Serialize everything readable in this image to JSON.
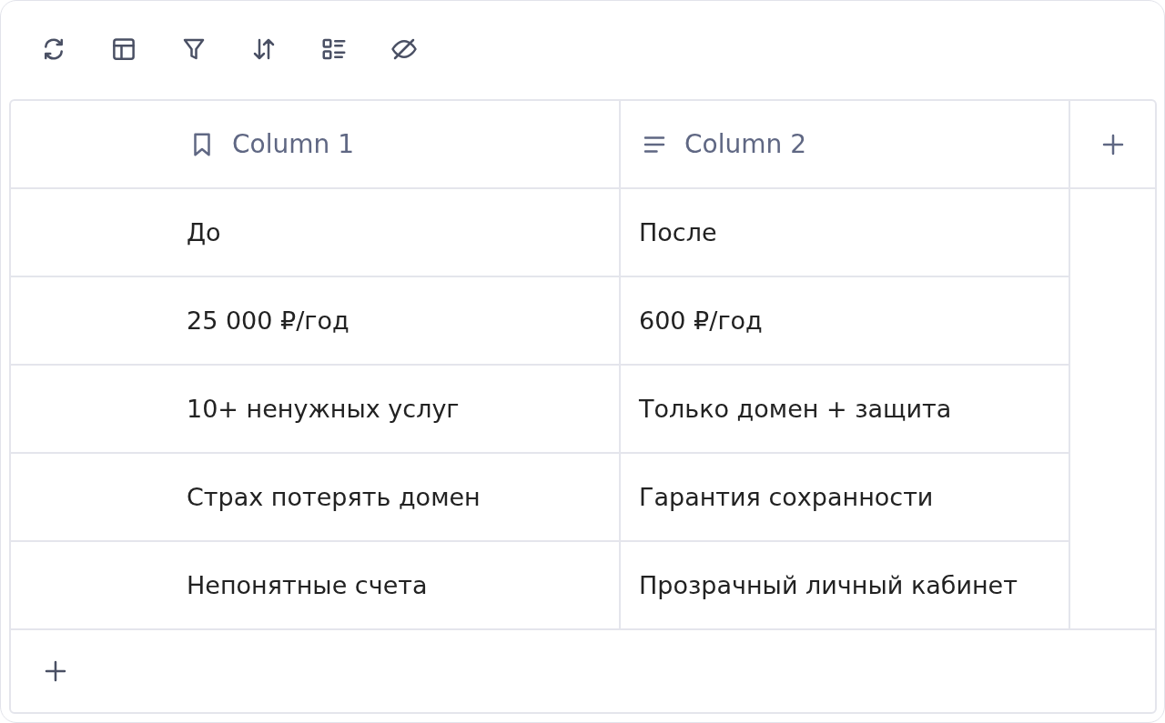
{
  "toolbar": {
    "buttons": [
      {
        "kind": "sync"
      },
      {
        "kind": "layout"
      },
      {
        "kind": "filter"
      },
      {
        "kind": "sort"
      },
      {
        "kind": "list"
      },
      {
        "kind": "hide"
      }
    ]
  },
  "table": {
    "columns": [
      {
        "name": "Column 1",
        "kind": "tag"
      },
      {
        "name": "Column 2",
        "kind": "text"
      }
    ],
    "rows": [
      [
        "До",
        "После"
      ],
      [
        "25 000 ₽/год",
        "600 ₽/год"
      ],
      [
        "10+ ненужных услуг",
        "Только домен + защита"
      ],
      [
        "Страх потерять домен",
        "Гарантия сохранности"
      ],
      [
        "Непонятные счета",
        "Прозрачный личный кабинет"
      ]
    ]
  }
}
